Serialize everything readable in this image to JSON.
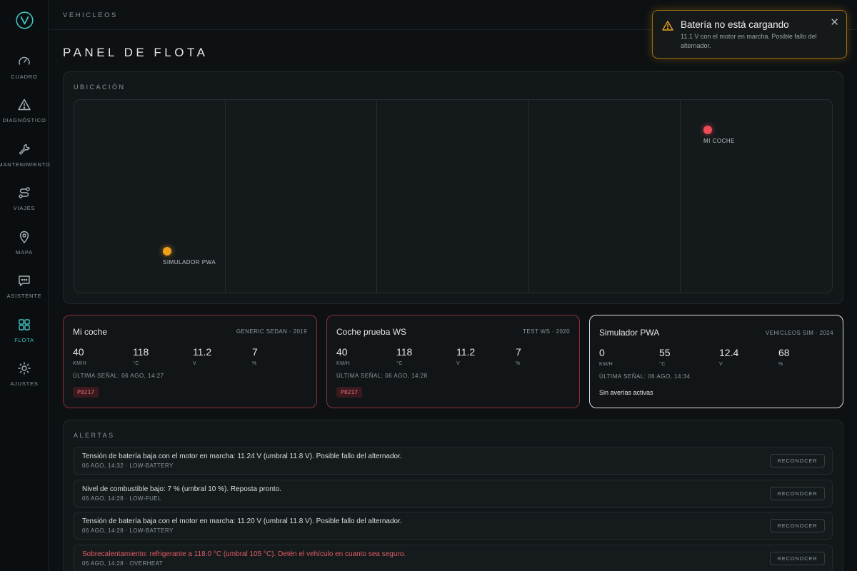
{
  "app": {
    "brand": "VEHICLEOS",
    "page_title": "PANEL DE FLOTA"
  },
  "sidebar": {
    "items": [
      {
        "label": "CUADRO",
        "icon": "gauge-icon"
      },
      {
        "label": "DIAGNÓSTICO",
        "icon": "warning-icon"
      },
      {
        "label": "MANTENIMIENTO",
        "icon": "wrench-icon"
      },
      {
        "label": "VIAJES",
        "icon": "route-icon"
      },
      {
        "label": "MAPA",
        "icon": "map-pin-icon"
      },
      {
        "label": "ASISTENTE",
        "icon": "chat-icon"
      },
      {
        "label": "FLOTA",
        "icon": "grid-icon",
        "active": true
      },
      {
        "label": "AJUSTES",
        "icon": "sun-gear-icon"
      }
    ]
  },
  "location": {
    "title": "UBICACIÓN",
    "markers": [
      {
        "label": "MI COCHE",
        "color": "#ef4a57"
      },
      {
        "label": "SIMULADOR PWA",
        "color": "#f0a018"
      }
    ]
  },
  "vehicles": [
    {
      "name": "Mi coche",
      "model": "GENERIC SEDAN · 2019",
      "speed": "40",
      "speed_unit": "KM/H",
      "temp": "118",
      "temp_unit": "°C",
      "voltage": "11.2",
      "voltage_unit": "V",
      "fuel": "7",
      "fuel_unit": "%",
      "last_signal": "ÚLTIMA SEÑAL: 06 AGO, 14:27",
      "code": "P0217"
    },
    {
      "name": "Coche prueba WS",
      "model": "TEST WS · 2020",
      "speed": "40",
      "speed_unit": "KM/H",
      "temp": "118",
      "temp_unit": "°C",
      "voltage": "11.2",
      "voltage_unit": "V",
      "fuel": "7",
      "fuel_unit": "%",
      "last_signal": "ÚLTIMA SEÑAL: 06 AGO, 14:28",
      "code": "P0217"
    },
    {
      "name": "Simulador PWA",
      "model": "VEHICLEOS SIM · 2024",
      "speed": "0",
      "speed_unit": "KM/H",
      "temp": "55",
      "temp_unit": "°C",
      "voltage": "12.4",
      "voltage_unit": "V",
      "fuel": "68",
      "fuel_unit": "%",
      "last_signal": "ÚLTIMA SEÑAL: 06 AGO, 14:34",
      "status": "Sin averías activas"
    }
  ],
  "alerts": {
    "title": "ALERTAS",
    "ack_label": "RECONOCER",
    "items": [
      {
        "message": "Tensión de batería baja con el motor en marcha: 11.24 V (umbral 11.8 V). Posible fallo del alternador.",
        "meta": "06 AGO, 14:32 · LOW-BATTERY"
      },
      {
        "message": "Nivel de combustible bajo: 7 % (umbral 10 %). Reposta pronto.",
        "meta": "06 AGO, 14:28 · LOW-FUEL"
      },
      {
        "message": "Tensión de batería baja con el motor en marcha: 11.20 V (umbral 11.8 V). Posible fallo del alternador.",
        "meta": "06 AGO, 14:28 · LOW-BATTERY"
      },
      {
        "message": "Sobrecalentamiento: refrigerante a 118.0 °C (umbral 105 °C). Detén el vehículo en cuanto sea seguro.",
        "meta": "06 AGO, 14:28 · OVERHEAT",
        "severity": "danger"
      }
    ]
  },
  "toast": {
    "title": "Batería no está cargando",
    "body": "11.1 V con el motor en marcha. Posible fallo del alternador.",
    "close_icon": "close-icon",
    "accent": "#e5a020"
  },
  "colors": {
    "accent": "#3fc4bd",
    "danger": "#e05b63",
    "warning": "#f0a018"
  }
}
